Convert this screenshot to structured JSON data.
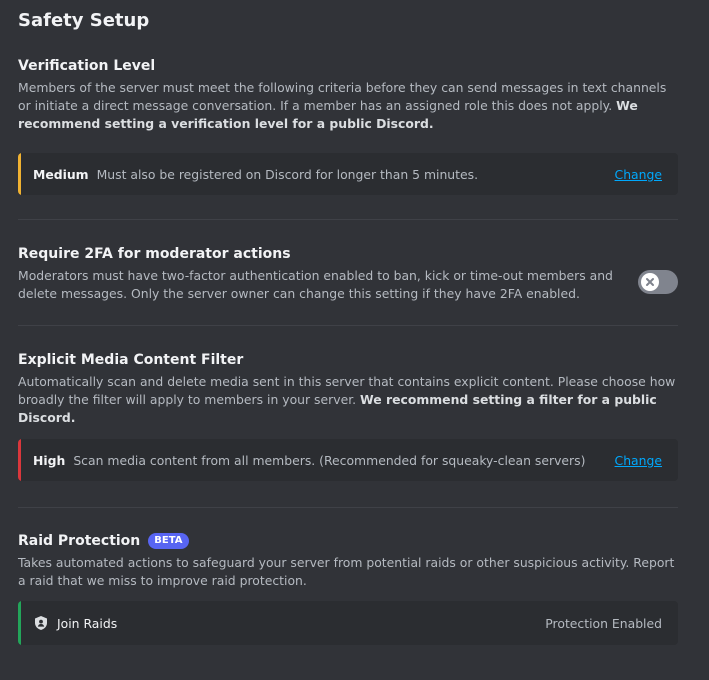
{
  "page": {
    "title": "Safety Setup"
  },
  "verification": {
    "heading": "Verification Level",
    "description": "Members of the server must meet the following criteria before they can send messages in text channels or initiate a direct message conversation. If a member has an assigned role this does not apply.",
    "recommendation": "We recommend setting a verification level for a public Discord.",
    "level": "Medium",
    "level_description": "Must also be registered on Discord for longer than 5 minutes.",
    "change_label": "Change",
    "accent_color": "#f0b232"
  },
  "mfa": {
    "heading": "Require 2FA for moderator actions",
    "description": "Moderators must have two-factor authentication enabled to ban, kick or time-out members and delete messages. Only the server owner can change this setting if they have 2FA enabled.",
    "enabled": false
  },
  "media_filter": {
    "heading": "Explicit Media Content Filter",
    "description": "Automatically scan and delete media sent in this server that contains explicit content. Please choose how broadly the filter will apply to members in your server.",
    "recommendation": "We recommend setting a filter for a public Discord.",
    "level": "High",
    "level_description": "Scan media content from all members. (Recommended for squeaky-clean servers)",
    "change_label": "Change",
    "accent_color": "#da373c"
  },
  "raid": {
    "heading": "Raid Protection",
    "badge": "BETA",
    "description": "Takes automated actions to safeguard your server from potential raids or other suspicious activity. Report a raid that we miss to improve raid protection.",
    "item_label": "Join Raids",
    "item_icon": "shield-icon",
    "status": "Protection Enabled",
    "accent_color": "#23a55a"
  }
}
